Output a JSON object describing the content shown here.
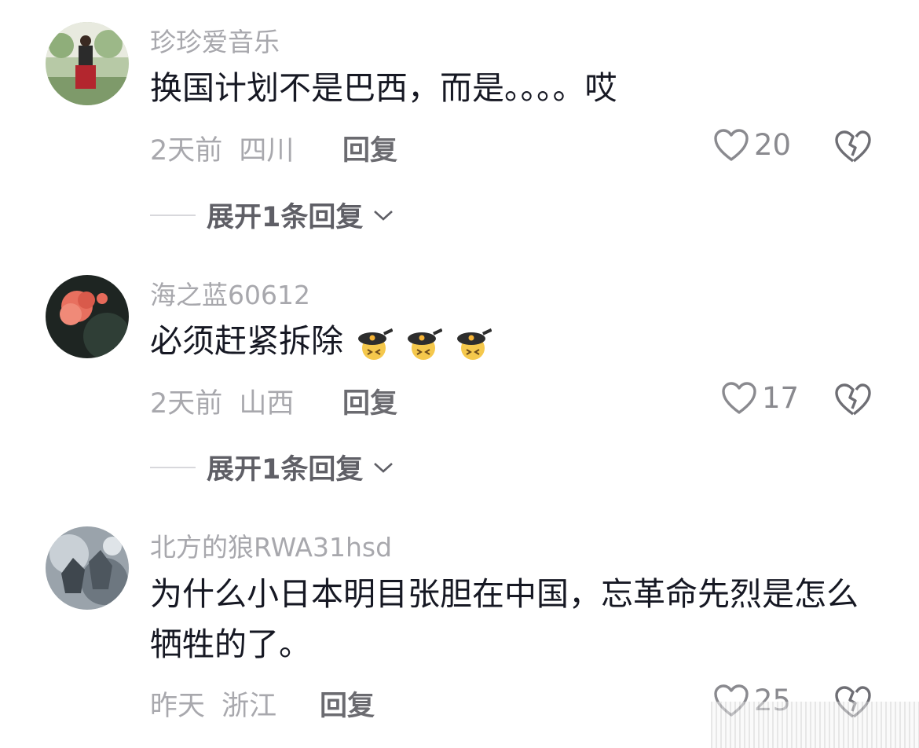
{
  "comments": [
    {
      "username": "珍珍爱音乐",
      "text": "换国计划不是巴西，而是。。。。哎",
      "time": "2天前",
      "location": "四川",
      "reply_label": "回复",
      "likes": "20",
      "expand_label": "展开1条回复"
    },
    {
      "username": "海之蓝60612",
      "text": "必须赶紧拆除",
      "time": "2天前",
      "location": "山西",
      "reply_label": "回复",
      "likes": "17",
      "expand_label": "展开1条回复"
    },
    {
      "username": "北方的狼RWA31hsd",
      "text": "为什么小日本明目张胆在中国，忘革命先烈是怎么牺牲的了。",
      "time": "昨天",
      "location": "浙江",
      "reply_label": "回复",
      "likes": "25"
    }
  ],
  "icons": {
    "like": "heart-outline-icon",
    "dislike": "broken-heart-icon",
    "expand": "chevron-down-icon",
    "emoji": "frying-pan-emoji"
  },
  "colors": {
    "text": "#161823",
    "secondary": "#a8a8ad",
    "reply": "#6b6b70"
  }
}
